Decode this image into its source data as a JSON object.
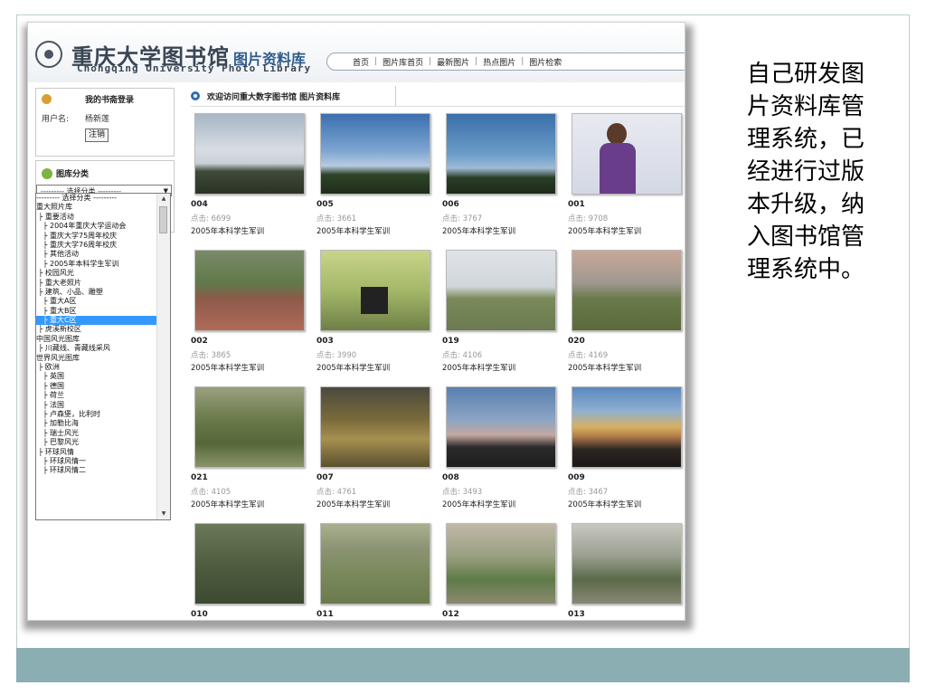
{
  "caption": [
    "自己研发图",
    "片资料库管",
    "理系统，已",
    "经进行过版",
    "本升级，纳",
    "入图书馆管",
    "理系统中。"
  ],
  "header": {
    "logo_cn": "重庆大学图书馆",
    "logo_cn_sub": "图片资料库",
    "logo_en": "Chongqing University Photo Library"
  },
  "nav": [
    "首页",
    "图片库首页",
    "最新图片",
    "热点图片",
    "图片检索"
  ],
  "login": {
    "title": "我的书斋登录",
    "user_label": "用户名:",
    "user_name": "杨新莲",
    "logout": "注销"
  },
  "category": {
    "title": "图库分类",
    "selected": "--------- 选择分类 ---------",
    "items": [
      "--------- 选择分类 ---------",
      "重大照片库",
      " ├ 重要活动",
      "   ├ 2004年重庆大学运动会",
      "   ├ 重庆大学75周年校庆",
      "   ├ 重庆大学76周年校庆",
      "   ├ 其他活动",
      "   ├ 2005年本科学生军训",
      " ├ 校园风光",
      " ├ 重大老照片",
      " ├ 建筑、小品、雕塑",
      "   ├ 重大A区",
      "   ├ 重大B区",
      "   ├ 重大C区",
      " ├ 虎溪新校区",
      "中国风光图库",
      " ├ 川藏线、青藏线采风",
      "世界风光图库",
      " ├ 欧洲",
      "   ├ 英国",
      "   ├ 德国",
      "   ├ 荷兰",
      "   ├ 法国",
      "   ├ 卢森堡，比利时",
      "   ├ 加勒比海",
      "   ├ 瑞士风光",
      "   ├ 巴黎风光",
      " ├ 环球风情",
      "   ├ 环球风情一",
      "   ├ 环球风情二"
    ],
    "selected_index": 13
  },
  "welcome": "欢迎访问重大数字图书馆 图片资料库",
  "photos": [
    {
      "id": "004",
      "hits": "点击: 6699",
      "cat": "2005年本科学生军训",
      "pic": "p-sky1"
    },
    {
      "id": "005",
      "hits": "点击: 3661",
      "cat": "2005年本科学生军训",
      "pic": "p-sky2"
    },
    {
      "id": "006",
      "hits": "点击: 3767",
      "cat": "2005年本科学生军训",
      "pic": "p-sky3"
    },
    {
      "id": "001",
      "hits": "点击: 9708",
      "cat": "2005年本科学生军训",
      "pic": "p-person"
    },
    {
      "id": "002",
      "hits": "点击: 3865",
      "cat": "2005年本科学生军训",
      "pic": "p-field"
    },
    {
      "id": "003",
      "hits": "点击: 3990",
      "cat": "2005年本科学生军训",
      "pic": "p-tent"
    },
    {
      "id": "019",
      "hits": "点击: 4106",
      "cat": "2005年本科学生军训",
      "pic": "p-march"
    },
    {
      "id": "020",
      "hits": "点击: 4169",
      "cat": "2005年本科学生军训",
      "pic": "p-march2"
    },
    {
      "id": "021",
      "hits": "点击: 4105",
      "cat": "2005年本科学生军训",
      "pic": "p-guns"
    },
    {
      "id": "007",
      "hits": "点击: 4761",
      "cat": "2005年本科学生军训",
      "pic": "p-officers"
    },
    {
      "id": "008",
      "hits": "点击: 3493",
      "cat": "2005年本科学生军训",
      "pic": "p-dusk1"
    },
    {
      "id": "009",
      "hits": "点击: 3467",
      "cat": "2005年本科学生军训",
      "pic": "p-dusk2"
    },
    {
      "id": "010",
      "hits": "",
      "cat": "",
      "pic": "p-drill1"
    },
    {
      "id": "011",
      "hits": "",
      "cat": "",
      "pic": "p-drill2"
    },
    {
      "id": "012",
      "hits": "",
      "cat": "",
      "pic": "p-drill3"
    },
    {
      "id": "013",
      "hits": "",
      "cat": "",
      "pic": "p-drill4"
    }
  ]
}
